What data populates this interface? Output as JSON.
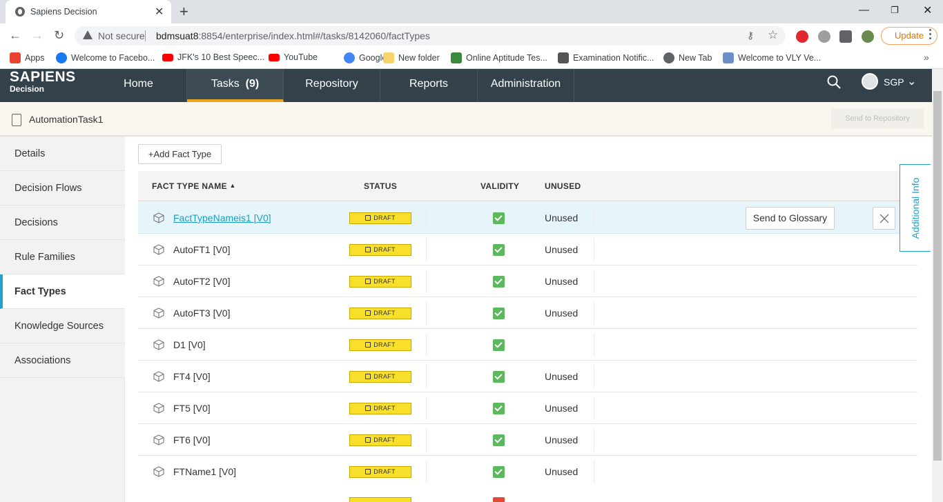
{
  "browser": {
    "tab_title": "Sapiens Decision",
    "security": "Not secure",
    "url_host": "bdmsuat8",
    "url_rest": ":8854/enterprise/index.html#/tasks/8142060/factTypes",
    "update_label": "Update",
    "bookmarks": [
      {
        "label": "Apps",
        "icon": "apps-grid-icon",
        "color": "#ea4335"
      },
      {
        "label": "Welcome to Facebo...",
        "icon": "facebook-icon",
        "color": "#1877f2"
      },
      {
        "label": "JFK's 10 Best Speec...",
        "icon": "youtube-icon",
        "color": "#ff0000"
      },
      {
        "label": "YouTube",
        "icon": "youtube-icon",
        "color": "#ff0000"
      },
      {
        "label": "Google",
        "icon": "google-icon",
        "color": "#4285f4"
      },
      {
        "label": "New folder",
        "icon": "folder-icon",
        "color": "#f6d36b"
      },
      {
        "label": "Online Aptitude Tes...",
        "icon": "palm-tree-icon",
        "color": "#3b8a3b"
      },
      {
        "label": "Examination Notific...",
        "icon": "emblem-icon",
        "color": "#555555"
      },
      {
        "label": "New Tab",
        "icon": "globe-icon",
        "color": "#5f6368"
      },
      {
        "label": "Welcome to VLY Ve...",
        "icon": "document-icon",
        "color": "#6b8fc7"
      }
    ]
  },
  "app": {
    "logo_line1": "SAPIENS",
    "logo_line2": "Decision",
    "nav": [
      {
        "label": "Home"
      },
      {
        "label": "Tasks",
        "count": "(9)"
      },
      {
        "label": "Repository"
      },
      {
        "label": "Reports"
      },
      {
        "label": "Administration"
      }
    ],
    "region": "SGP",
    "task_name": "AutomationTask1",
    "send_to_repository": "Send to Repository",
    "sidebar": [
      {
        "label": "Details"
      },
      {
        "label": "Decision Flows"
      },
      {
        "label": "Decisions"
      },
      {
        "label": "Rule Families"
      },
      {
        "label": "Fact Types",
        "active": true
      },
      {
        "label": "Knowledge Sources"
      },
      {
        "label": "Associations"
      }
    ],
    "add_fact_type": "+Add Fact Type",
    "columns": {
      "name": "FACT TYPE NAME",
      "status": "STATUS",
      "validity": "VALIDITY",
      "unused": "UNUSED"
    },
    "rows": [
      {
        "name": "FactTypeNameis1 [V0]",
        "status": "DRAFT",
        "valid": true,
        "unused": "Unused",
        "selected": true
      },
      {
        "name": "AutoFT1 [V0]",
        "status": "DRAFT",
        "valid": true,
        "unused": "Unused"
      },
      {
        "name": "AutoFT2 [V0]",
        "status": "DRAFT",
        "valid": true,
        "unused": "Unused"
      },
      {
        "name": "AutoFT3 [V0]",
        "status": "DRAFT",
        "valid": true,
        "unused": "Unused"
      },
      {
        "name": "D1 [V0]",
        "status": "DRAFT",
        "valid": true,
        "unused": ""
      },
      {
        "name": "FT4 [V0]",
        "status": "DRAFT",
        "valid": true,
        "unused": "Unused"
      },
      {
        "name": "FT5 [V0]",
        "status": "DRAFT",
        "valid": true,
        "unused": "Unused"
      },
      {
        "name": "FT6 [V0]",
        "status": "DRAFT",
        "valid": true,
        "unused": "Unused"
      },
      {
        "name": "FTName1 [V0]",
        "status": "DRAFT",
        "valid": true,
        "unused": "Unused"
      }
    ],
    "send_to_glossary": "Send to Glossary",
    "additional_info": "Additional Info"
  }
}
